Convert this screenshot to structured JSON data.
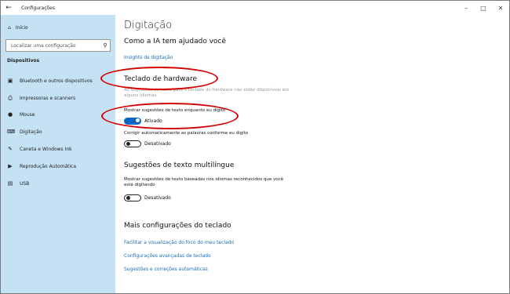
{
  "window": {
    "title": "Configurações",
    "back_icon": "arrow-left-icon",
    "controls": [
      "minimize-icon",
      "maximize-icon",
      "close-icon"
    ]
  },
  "sidebar": {
    "home_label": "Início",
    "search_placeholder": "Localizar uma configuração",
    "section": "Dispositivos",
    "items": [
      {
        "label": "Bluetooth e outros dispositivos",
        "icon": "bluetooth-icon"
      },
      {
        "label": "Impressoras e scanners",
        "icon": "printer-icon"
      },
      {
        "label": "Mouse",
        "icon": "mouse-icon"
      },
      {
        "label": "Digitação",
        "icon": "keyboard-icon"
      },
      {
        "label": "Caneta e Windows Ink",
        "icon": "pen-icon"
      },
      {
        "label": "Reprodução Automática",
        "icon": "autoplay-icon"
      },
      {
        "label": "USB",
        "icon": "usb-icon"
      }
    ]
  },
  "main": {
    "title": "Digitação",
    "ia_heading": "Como a IA tem ajudado você",
    "ia_link": "Insights de digitação",
    "hw_heading": "Teclado de hardware",
    "hw_desc": "As sugestões de texto para o teclado do hardware não estão disponíveis em alguns idiomas",
    "show_suggestions_label": "Mostrar sugestões de texto enquanto eu digito",
    "show_suggestions_state": "Ativado",
    "autocorrect_label": "Corrigir automaticamente as palavras conforme eu digito",
    "autocorrect_state": "Desativado",
    "multi_heading": "Sugestões de texto multilíngue",
    "multi_desc": "Mostrar sugestões de texto baseadas nos idiomas reconhecidos que você está digitando",
    "multi_state": "Desativado",
    "more_heading": "Mais configurações do teclado",
    "links": [
      "Facilitar a visualização do foco do meu teclado",
      "Configurações avançadas de teclado",
      "Sugestões e correções automáticas"
    ]
  },
  "annotation_color": "#d50000"
}
